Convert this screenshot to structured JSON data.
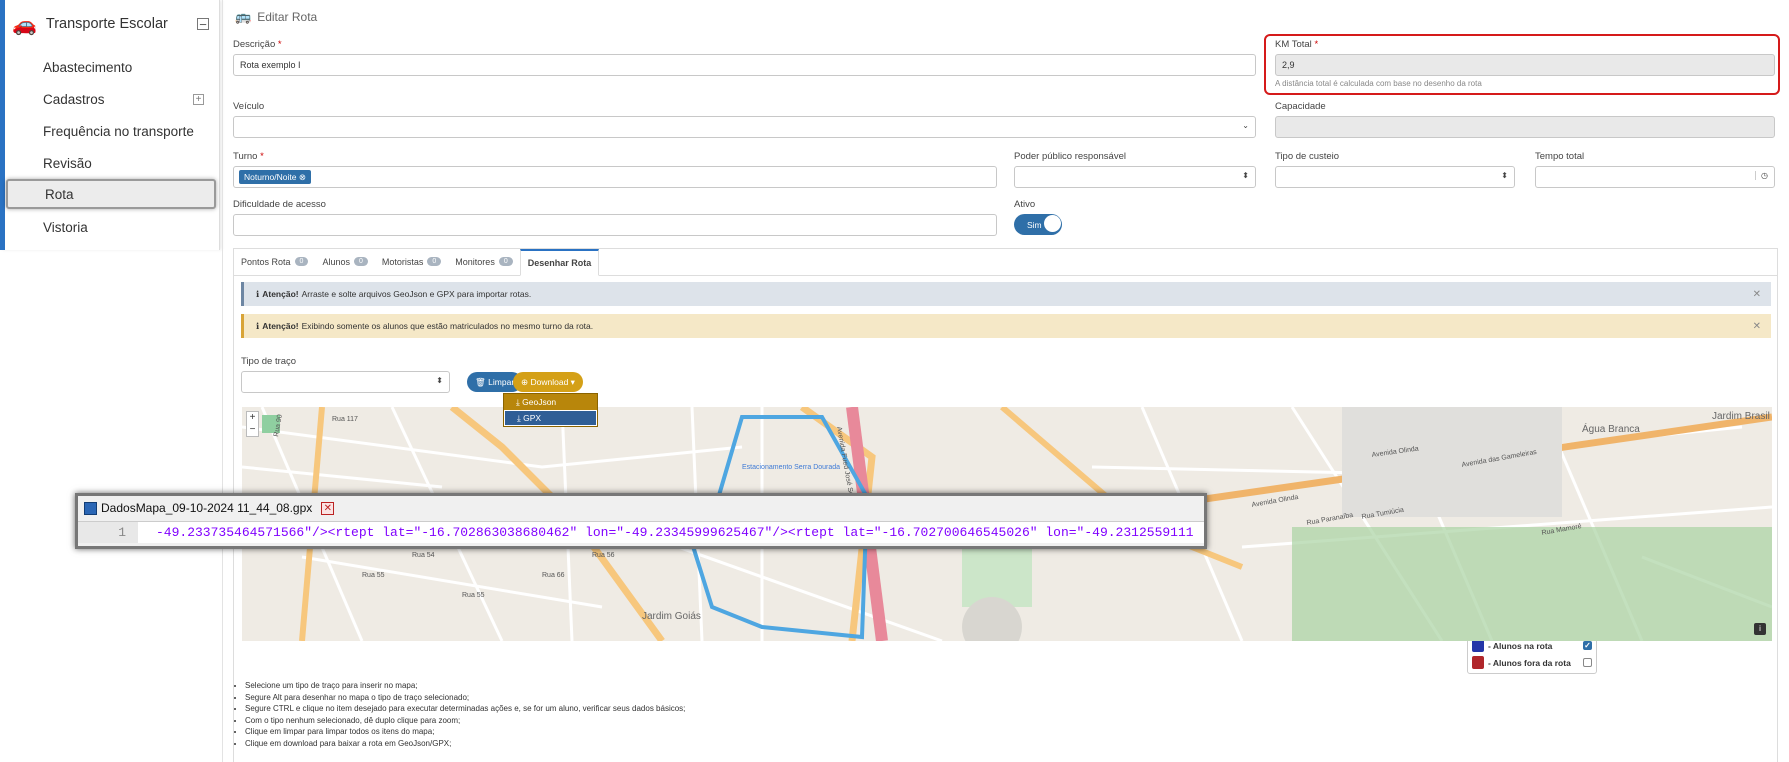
{
  "sidebar": {
    "title": "Transporte Escolar",
    "items": [
      {
        "label": "Abastecimento",
        "expandable": false,
        "active": false
      },
      {
        "label": "Cadastros",
        "expandable": true,
        "active": false
      },
      {
        "label": "Frequência no transporte",
        "expandable": false,
        "active": false
      },
      {
        "label": "Revisão",
        "expandable": false,
        "active": false
      },
      {
        "label": "Rota",
        "expandable": false,
        "active": true
      },
      {
        "label": "Vistoria",
        "expandable": false,
        "active": false
      }
    ]
  },
  "header": {
    "title": "Editar Rota"
  },
  "form": {
    "descricao_label": "Descrição",
    "descricao_value": "Rota exemplo I",
    "km_label": "KM Total",
    "km_value": "2,9",
    "km_hint": "A distância total é calculada com base no desenho da rota",
    "veiculo_label": "Veículo",
    "capacidade_label": "Capacidade",
    "turno_label": "Turno",
    "turno_tag": "Noturno/Noite",
    "poder_label": "Poder público responsável",
    "custeio_label": "Tipo de custeio",
    "tempo_label": "Tempo total",
    "dificuldade_label": "Dificuldade de acesso",
    "ativo_label": "Ativo",
    "ativo_value": "Sim",
    "required_mark": "*"
  },
  "tabs": [
    {
      "label": "Pontos Rota",
      "count": "0"
    },
    {
      "label": "Alunos",
      "count": "0"
    },
    {
      "label": "Motoristas",
      "count": "0"
    },
    {
      "label": "Monitores",
      "count": "0"
    },
    {
      "label": "Desenhar Rota",
      "count": null
    }
  ],
  "alerts": {
    "info_title": "Atenção!",
    "info_text": "Arraste e solte arquivos GeoJson e GPX para importar rotas.",
    "warn_title": "Atenção!",
    "warn_text": "Exibindo somente os alunos que estão matriculados no mesmo turno da rota."
  },
  "draw": {
    "tipo_label": "Tipo de traço",
    "limpar_label": "Limpar",
    "download_label": "Download",
    "dropdown": [
      "GeoJson",
      "GPX"
    ],
    "legend_in": "- Alunos na rota",
    "legend_out": "- Alunos fora da rota"
  },
  "map": {
    "labels": [
      "Água Branca",
      "Jardim Brasil",
      "Jardim Goiás",
      "Avenida Olinda",
      "Avenida das Gameleiras",
      "Avenida Olinda",
      "Rua Paranaíba",
      "Rua Tumiúcia",
      "Rua Mamoré",
      "Rua 117",
      "Rua 90",
      "Estacionamento Serra Dourada",
      "Avenida Fued José Sebba",
      "Rua 55",
      "Rua 54",
      "Rua 55",
      "Rua 66",
      "Rua 56"
    ]
  },
  "notes": [
    "Selecione um tipo de traço para inserir no mapa;",
    "Segure Alt para desenhar no mapa o tipo de traço selecionado;",
    "Segure CTRL e clique no item desejado para executar determinadas ações e, se for um aluno, verificar seus dados básicos;",
    "Com o tipo nenhum selecionado, dê duplo clique para zoom;",
    "Clique em limpar para limpar todos os itens do mapa;",
    "Clique em download para baixar a rota em GeoJson/GPX;"
  ],
  "editor": {
    "filename": "DadosMapa_09-10-2024 11_44_08.gpx",
    "line_no": "1",
    "code": "-49.233735464571566\"/><rtept lat=\"-16.702863038680462\" lon=\"-49.23345999625467\"/><rtept lat=\"-16.702700646545026\" lon=\"-49.2312559111"
  },
  "colors": {
    "accent": "#2a72c3",
    "highlight": "#d51a1a",
    "download": "#d4a017",
    "tag": "#2f6fa8"
  }
}
